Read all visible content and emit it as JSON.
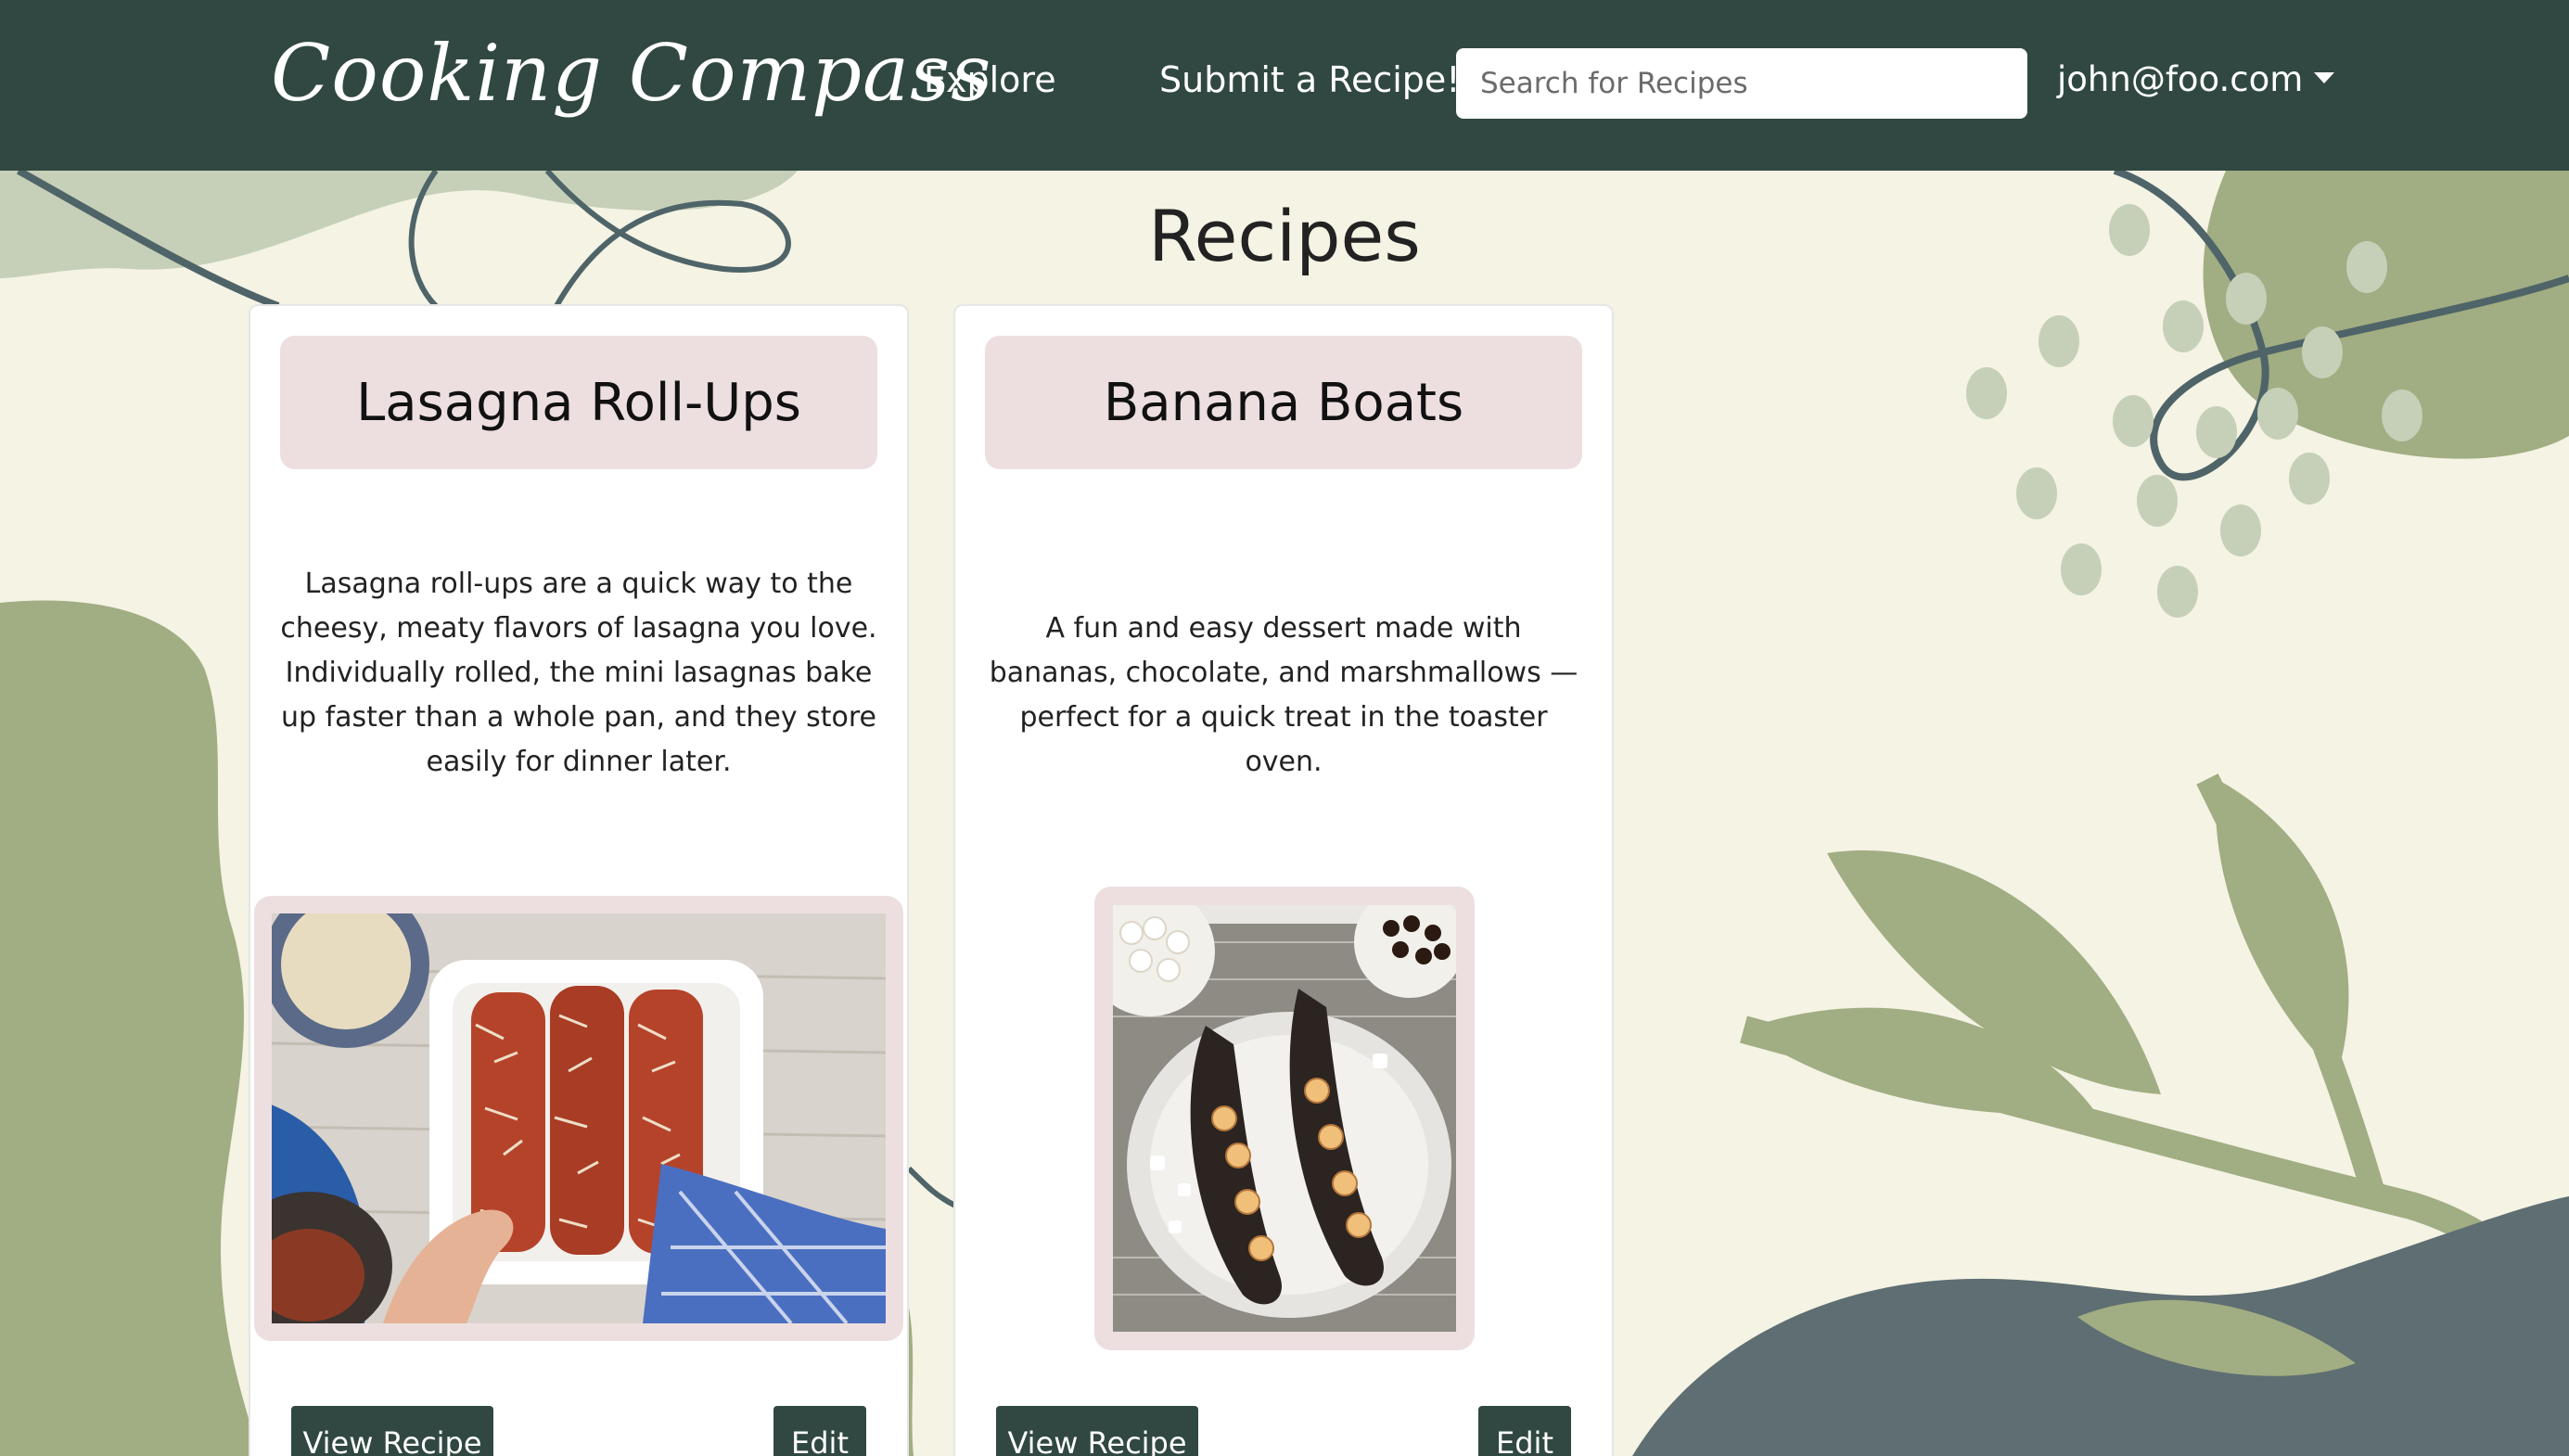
{
  "navbar": {
    "brand": "Cooking Compass",
    "links": [
      {
        "label": "Explore"
      },
      {
        "label": "Submit a Recipe!"
      }
    ],
    "search": {
      "placeholder": "Search for Recipes",
      "value": ""
    },
    "user": {
      "email": "john@foo.com"
    }
  },
  "page": {
    "title": "Recipes"
  },
  "recipes": [
    {
      "title": "Lasagna Roll-Ups",
      "description": "Lasagna roll-ups are a quick way to the cheesy, meaty flavors of lasagna you love. Individually rolled, the mini lasagnas bake up faster than a whole pan, and they store easily for dinner later.",
      "image_subject": "lasagna roll-ups in a white baking dish",
      "view_label": "View Recipe",
      "edit_label": "Edit"
    },
    {
      "title": "Banana Boats",
      "description": "A fun and easy dessert made with bananas, chocolate, and marshmallows — perfect for a quick treat in the toaster oven.",
      "image_subject": "grilled banana boats with marshmallows and chocolate chips",
      "view_label": "View Recipe",
      "edit_label": "Edit"
    }
  ],
  "colors": {
    "navbar": "#304841",
    "background": "#f4f3e4",
    "card_title_bg": "#eddfe0",
    "button": "#304841",
    "leaf_green": "#a1ad82",
    "slate": "#5e6e72"
  },
  "icons": {
    "user_menu": "caret-down-icon"
  }
}
